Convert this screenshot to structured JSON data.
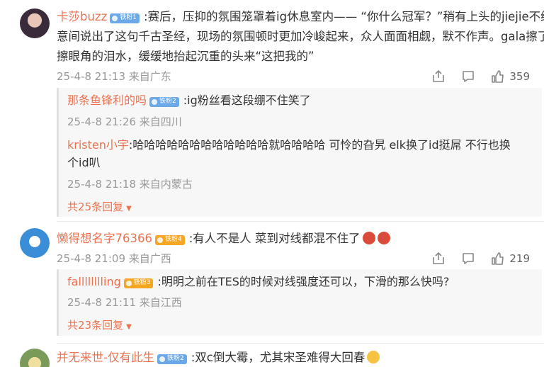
{
  "comments": [
    {
      "username": "卡莎buzz",
      "badge": "铁粉1",
      "text_line1": ":赛后，压抑的氛围笼罩着ig休息室内—— “你什么冠军？”稍有上头的jiejie不经",
      "text_line2": "意间说出了这句千古圣经，现场的氛围顿时更加冷峻起来，众人面面相觑，默不作声。gala擦了",
      "text_line3": "擦眼角的泪水，缓缓地抬起沉重的头来“这把我的”",
      "meta": "25-4-8 21:13 来自广东",
      "likes": "359",
      "replies": [
        {
          "username": "那条鱼锋利的吗",
          "badge": "铁粉2",
          "text": ":ig粉丝看这段绷不住笑了",
          "meta": "25-4-8 21:26 来自四川"
        },
        {
          "username": "kristen小宇",
          "text_line1": ":哈哈哈哈哈哈哈哈哈哈哈哈就哈哈哈哈 可怜的旮旯 elk换了id挺屌 不行也换",
          "text_line2": "个id叭",
          "meta": "25-4-8 21:18 来自内蒙古"
        }
      ],
      "more_replies": "共25条回复"
    },
    {
      "username": "懒得想名字76366",
      "badge": "铁粉4",
      "text": ":有人不是人 菜到对线都混不住了",
      "meta": "25-4-8 21:09 来自广西",
      "likes": "219",
      "replies": [
        {
          "username": "falllllllling",
          "badge": "铁粉3",
          "text": ":明明之前在TES的时候对线强度还可以，下滑的那么快吗?",
          "meta": "25-4-8 21:11 来自江西"
        }
      ],
      "more_replies": "共23条回复"
    },
    {
      "username": "并无来世-仅有此生",
      "badge": "铁粉2",
      "text": ":双c倒大霉，尤其宋圣难得大回春"
    }
  ],
  "icons": [
    "share-icon",
    "comment-icon",
    "like-icon",
    "chevron-down-icon"
  ],
  "colors": {
    "username": "#eb7350",
    "meta": "#999999",
    "reply_bg": "#f7f7f7",
    "badge_blue": "#6aa8e8",
    "badge_gold": "#f5a623"
  }
}
